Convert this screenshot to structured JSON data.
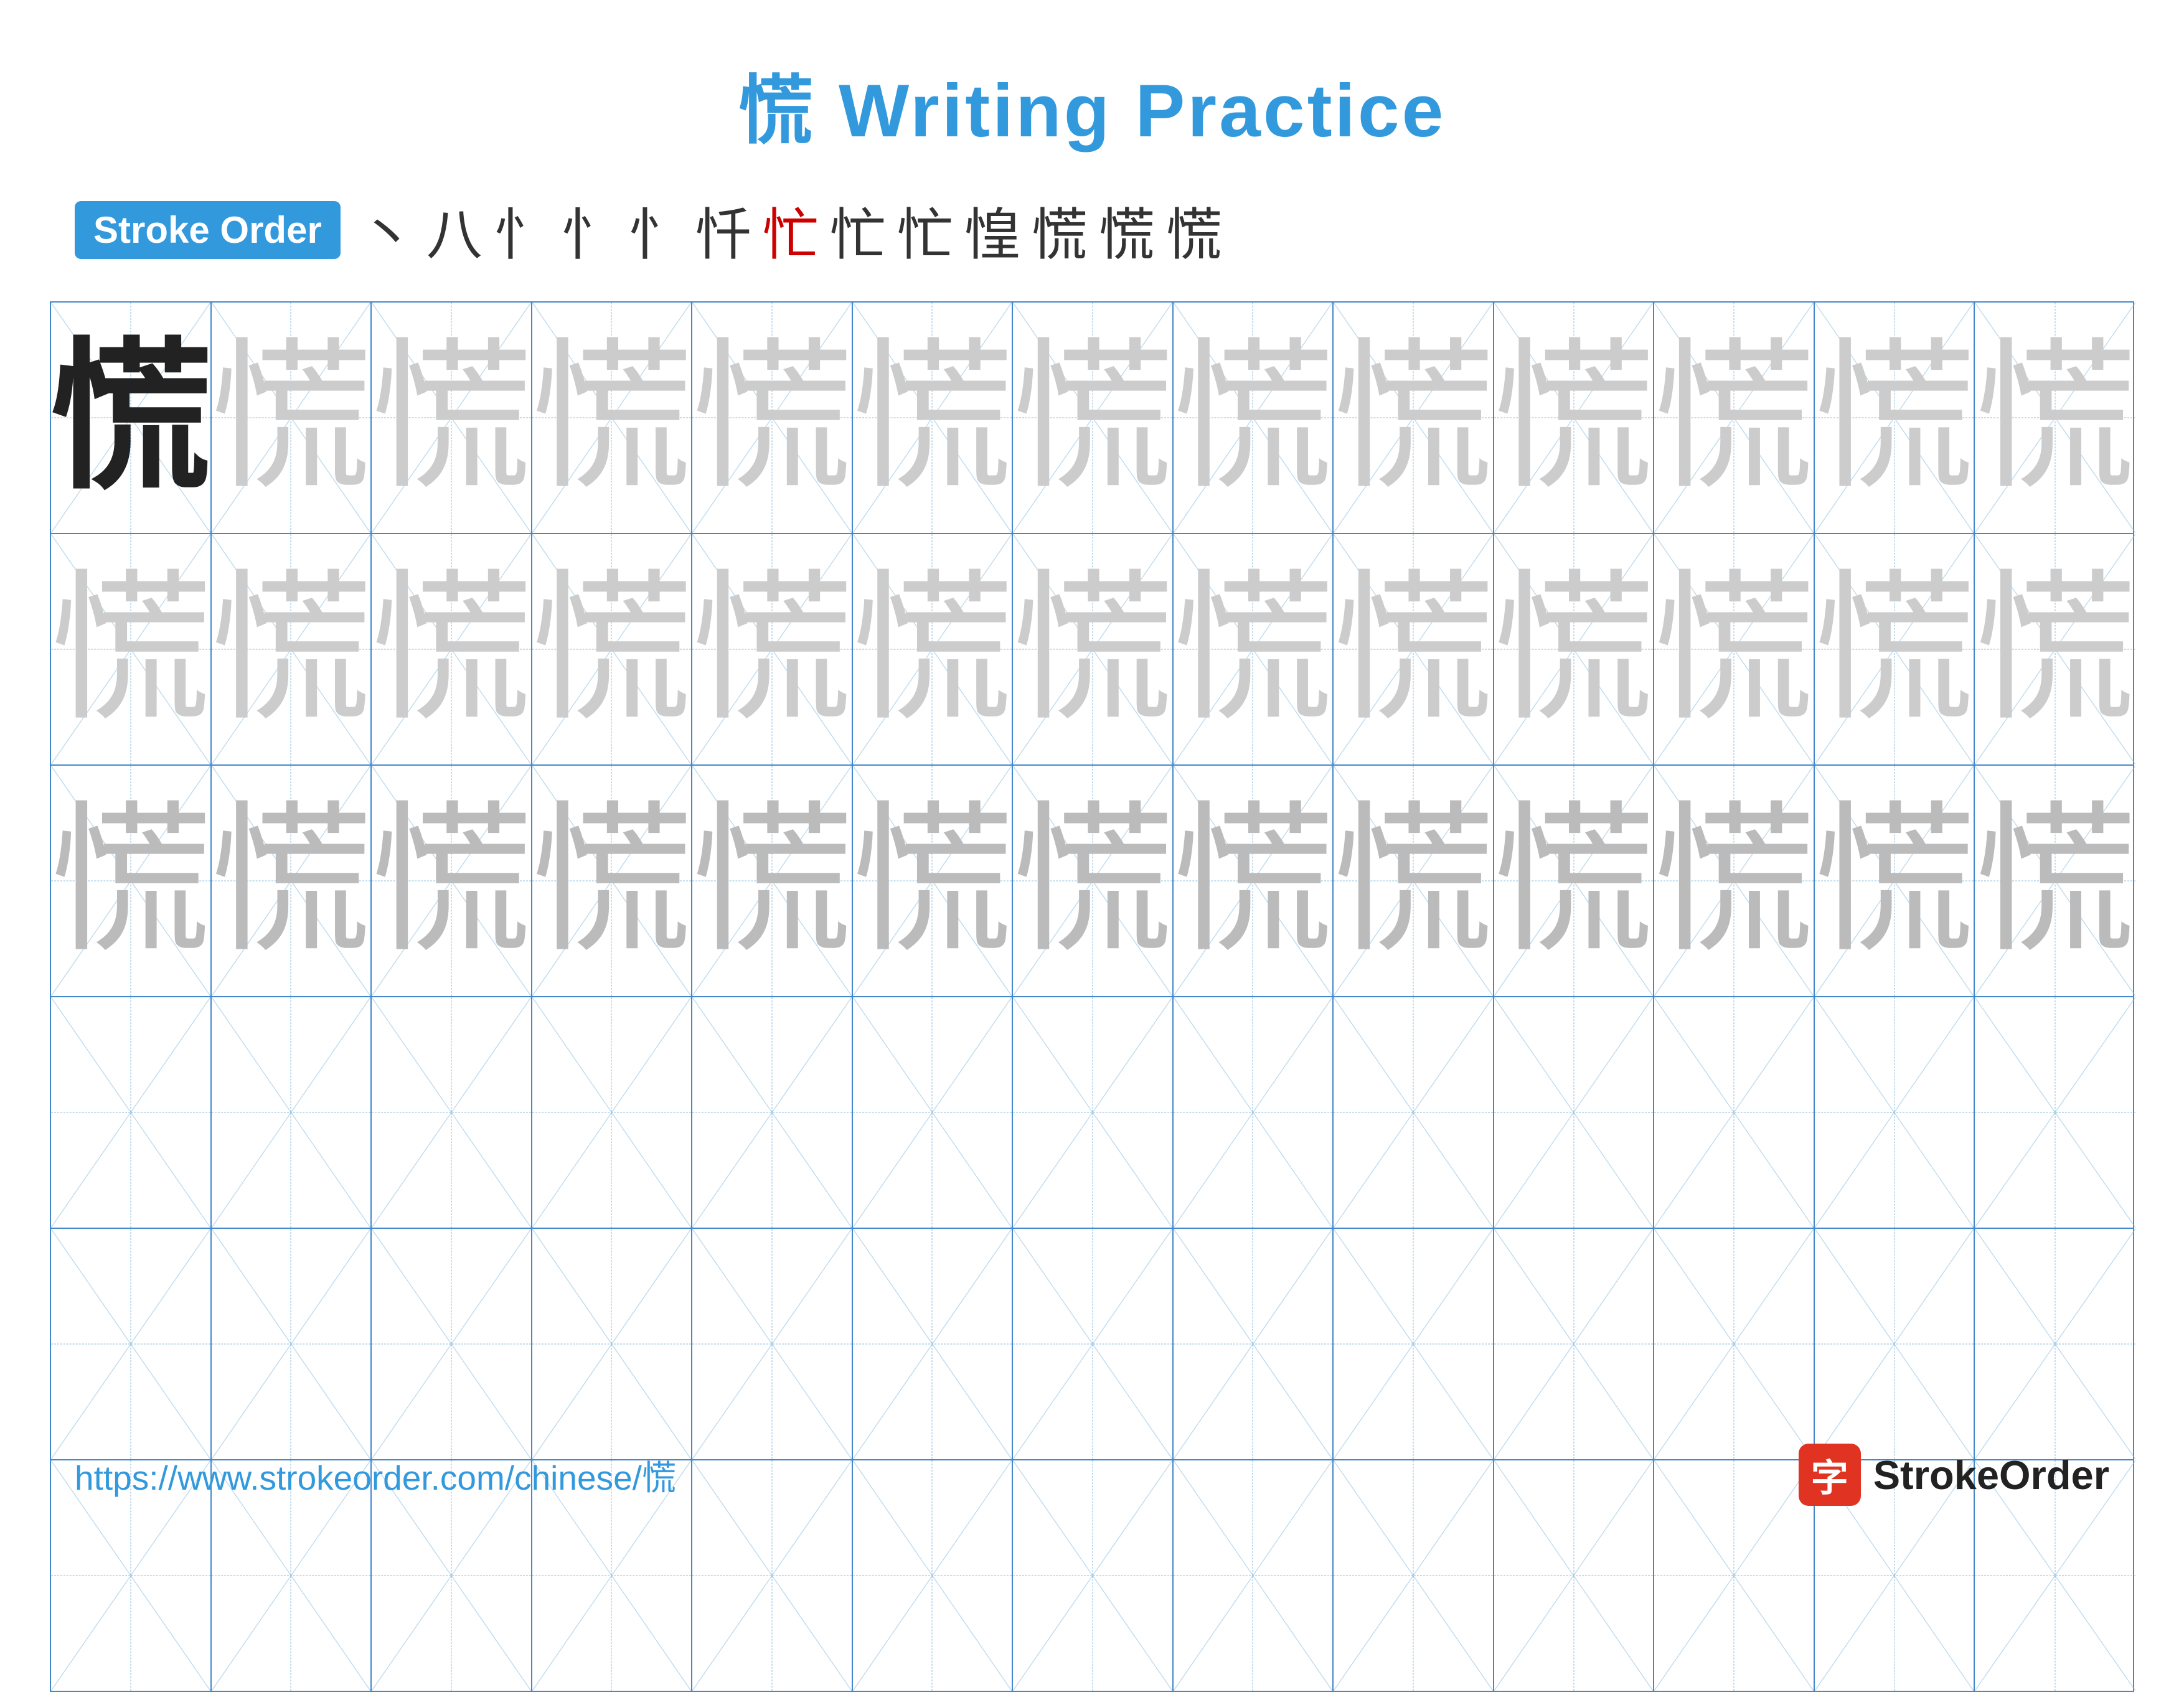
{
  "title": {
    "char": "慌",
    "text": " Writing Practice",
    "full": "慌 Writing Practice"
  },
  "stroke_order": {
    "badge_label": "Stroke Order",
    "sequence": [
      "丶",
      "八",
      "忄",
      "忄",
      "忄",
      "忏",
      "忙",
      "忙",
      "忙",
      "惶",
      "慌",
      "慌",
      "慌"
    ]
  },
  "practice": {
    "character": "慌",
    "rows": 6,
    "cols": 13,
    "row_types": [
      "bold_then_light",
      "light",
      "lighter",
      "empty",
      "empty",
      "empty"
    ]
  },
  "footer": {
    "url": "https://www.strokeorder.com/chinese/慌",
    "logo_icon": "字",
    "logo_text": "StrokeOrder"
  },
  "colors": {
    "blue": "#3399dd",
    "red": "#cc0000",
    "dark": "#222222",
    "light_char": "#cccccc",
    "medium_char": "#bbbbbb",
    "badge_bg": "#3399dd",
    "grid_border": "#4488cc",
    "guide_line": "#88bbdd"
  }
}
